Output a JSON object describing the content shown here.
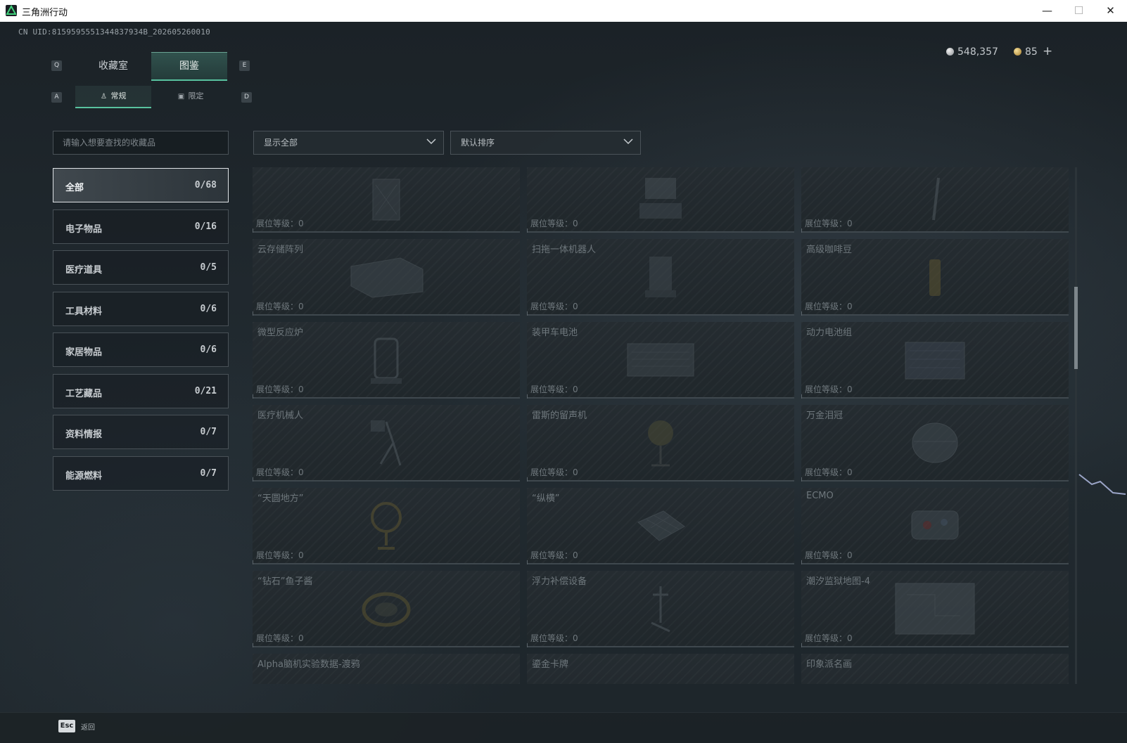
{
  "window": {
    "title": "三角洲行动",
    "minimize": "—",
    "maximize": "☐",
    "close": "✕"
  },
  "header": {
    "uid": "CN UID:8159595551344837934B_202605260010",
    "currency": [
      {
        "icon": "silver-coin-icon",
        "value": "548,357"
      },
      {
        "icon": "gold-coin-icon",
        "value": "85"
      }
    ],
    "add_label": "+"
  },
  "tabs": {
    "prev_key": "Q",
    "next_key": "E",
    "items": [
      {
        "label": "收藏室"
      },
      {
        "label": "图鉴",
        "active": true
      }
    ]
  },
  "subtabs": {
    "prev_key": "A",
    "next_key": "D",
    "items": [
      {
        "label": "常规",
        "active": true
      },
      {
        "label": "限定"
      }
    ]
  },
  "search": {
    "placeholder": "请输入想要查找的收藏品"
  },
  "filters": {
    "show": "显示全部",
    "sort": "默认排序"
  },
  "categories": [
    {
      "name": "全部",
      "count": "0/68",
      "active": true
    },
    {
      "name": "电子物品",
      "count": "0/16"
    },
    {
      "name": "医疗道具",
      "count": "0/5"
    },
    {
      "name": "工具材料",
      "count": "0/6"
    },
    {
      "name": "家居物品",
      "count": "0/6"
    },
    {
      "name": "工艺藏品",
      "count": "0/21"
    },
    {
      "name": "资料情报",
      "count": "0/7"
    },
    {
      "name": "能源燃料",
      "count": "0/7"
    }
  ],
  "level_label": "展位等级：0",
  "items": [
    {
      "name": ""
    },
    {
      "name": ""
    },
    {
      "name": ""
    },
    {
      "name": "云存储阵列"
    },
    {
      "name": "扫拖一体机器人"
    },
    {
      "name": "高级咖啡豆"
    },
    {
      "name": "微型反应炉"
    },
    {
      "name": "装甲车电池"
    },
    {
      "name": "动力电池组"
    },
    {
      "name": "医疗机械人"
    },
    {
      "name": "雷斯的留声机"
    },
    {
      "name": "万金泪冠"
    },
    {
      "name": "“天圆地方”"
    },
    {
      "name": "“纵横”"
    },
    {
      "name": "ECMO"
    },
    {
      "name": "“钻石”鱼子酱"
    },
    {
      "name": "浮力补偿设备"
    },
    {
      "name": "潮汐监狱地图-4"
    },
    {
      "name": "Alpha脑机实验数据-渡鸦"
    },
    {
      "name": "鎏金卡牌"
    },
    {
      "name": "印象派名画"
    }
  ],
  "footer": {
    "key": "Esc",
    "label": "返回"
  }
}
